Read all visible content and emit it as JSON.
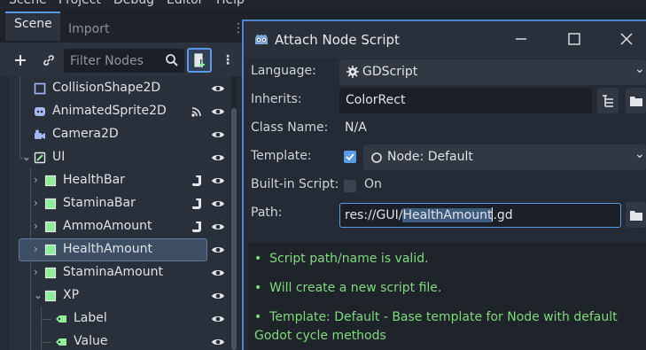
{
  "menu": [
    "Scene",
    "Project",
    "Debug",
    "Editor",
    "Help"
  ],
  "scene_dock": {
    "tabs": [
      {
        "label": "Scene",
        "active": true
      },
      {
        "label": "Import",
        "active": false
      }
    ],
    "filter_placeholder": "Filter Nodes",
    "nodes": [
      {
        "label": "CollisionShape2D",
        "icon": "collision-shape-icon",
        "badge": "",
        "expanded": null,
        "selected": false
      },
      {
        "label": "AnimatedSprite2D",
        "icon": "animated-sprite-icon",
        "badge": "signal-icon",
        "expanded": null,
        "selected": false
      },
      {
        "label": "Camera2D",
        "icon": "camera-icon",
        "badge": "",
        "expanded": null,
        "selected": false
      },
      {
        "label": "UI",
        "icon": "control-icon",
        "badge": "",
        "expanded": true,
        "selected": false
      },
      {
        "label": "HealthBar",
        "icon": "color-rect-icon",
        "badge": "script-icon",
        "expanded": false,
        "selected": false
      },
      {
        "label": "StaminaBar",
        "icon": "color-rect-icon",
        "badge": "script-icon",
        "expanded": false,
        "selected": false
      },
      {
        "label": "AmmoAmount",
        "icon": "color-rect-icon",
        "badge": "script-icon",
        "expanded": false,
        "selected": false
      },
      {
        "label": "HealthAmount",
        "icon": "color-rect-icon",
        "badge": "",
        "expanded": false,
        "selected": true
      },
      {
        "label": "StaminaAmount",
        "icon": "color-rect-icon",
        "badge": "",
        "expanded": false,
        "selected": false
      },
      {
        "label": "XP",
        "icon": "color-rect-icon",
        "badge": "",
        "expanded": true,
        "selected": false
      },
      {
        "label": "Label",
        "icon": "label-icon",
        "badge": "",
        "expanded": null,
        "selected": false
      },
      {
        "label": "Value",
        "icon": "label-icon",
        "badge": "",
        "expanded": null,
        "selected": false
      }
    ]
  },
  "dialog": {
    "title": "Attach Node Script",
    "language_label": "Language:",
    "language_value": "GDScript",
    "inherits_label": "Inherits:",
    "inherits_value": "ColorRect",
    "class_name_label": "Class Name:",
    "class_name_value": "N/A",
    "template_label": "Template:",
    "template_checked": true,
    "template_value": "Node: Default",
    "builtin_label": "Built-in Script:",
    "builtin_checked": false,
    "builtin_on": "On",
    "path_label": "Path:",
    "path_prefix": "res://GUI/",
    "path_selected": "HealthAmount",
    "path_suffix": ".gd",
    "messages": [
      "Script path/name is valid.",
      "Will create a new script file.",
      "Template: Default - Base template for Node with default Godot cycle methods"
    ]
  },
  "colors": {
    "accent": "#5a9be8",
    "valid_message": "#7fd97f",
    "selected_row": "#3e4f64",
    "color_rect_icon": "#8eef97",
    "camera_icon": "#a5b7f3"
  }
}
